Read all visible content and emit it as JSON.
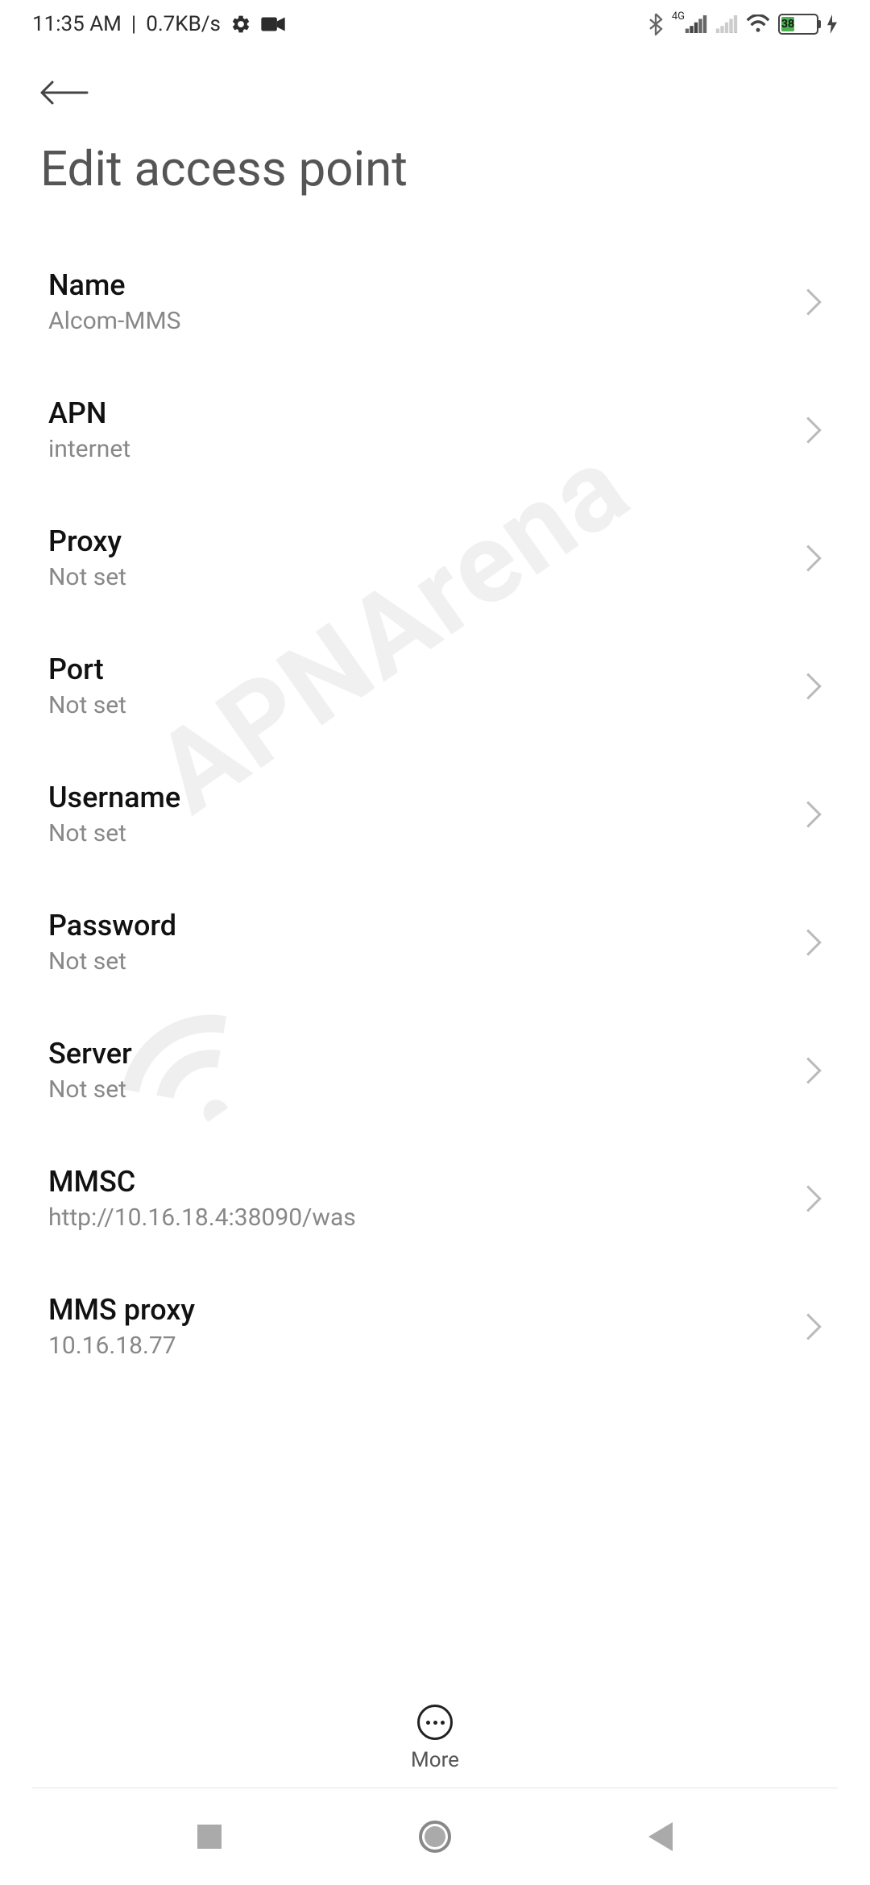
{
  "status_bar": {
    "time": "11:35 AM",
    "data_rate": "0.7KB/s",
    "cell_label": "4G",
    "battery_level": "38"
  },
  "page": {
    "title": "Edit access point"
  },
  "settings": [
    {
      "label": "Name",
      "value": "Alcom-MMS"
    },
    {
      "label": "APN",
      "value": "internet"
    },
    {
      "label": "Proxy",
      "value": "Not set"
    },
    {
      "label": "Port",
      "value": "Not set"
    },
    {
      "label": "Username",
      "value": "Not set"
    },
    {
      "label": "Password",
      "value": "Not set"
    },
    {
      "label": "Server",
      "value": "Not set"
    },
    {
      "label": "MMSC",
      "value": "http://10.16.18.4:38090/was"
    },
    {
      "label": "MMS proxy",
      "value": "10.16.18.77"
    }
  ],
  "bottom_action": {
    "more_label": "More"
  },
  "watermark": "APNArena"
}
